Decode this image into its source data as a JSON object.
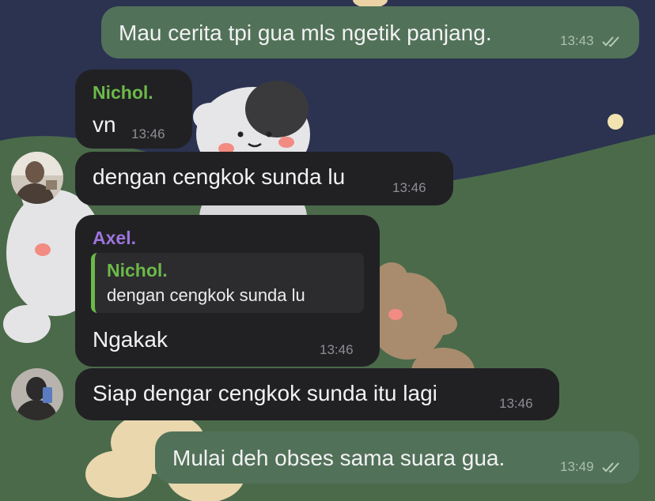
{
  "conversation": {
    "messages": [
      {
        "direction": "outgoing",
        "text": "Mau cerita tpi gua mls ngetik panjang.",
        "time": "13:43",
        "status": "read"
      },
      {
        "direction": "incoming",
        "sender": "Nichol.",
        "text": "vn",
        "time": "13:46"
      },
      {
        "direction": "incoming",
        "text": "dengan cengkok sunda lu",
        "time": "13:46"
      },
      {
        "direction": "incoming",
        "sender": "Axel.",
        "reply_to": {
          "sender": "Nichol.",
          "text": "dengan cengkok sunda lu"
        },
        "text": "Ngakak",
        "time": "13:46"
      },
      {
        "direction": "incoming",
        "text": "Siap dengar cengkok sunda itu lagi",
        "time": "13:46"
      },
      {
        "direction": "outgoing",
        "text": "Mulai deh obses sama suara gua.",
        "time": "13:49",
        "status": "read"
      }
    ]
  },
  "colors": {
    "outgoing_bubble": "#527159",
    "incoming_bubble": "#212124",
    "sender_nichol": "#6cba48",
    "sender_axel": "#9e74dc",
    "wallpaper_sky": "#2b3350",
    "wallpaper_hill": "#4b6a4a"
  },
  "icons": {
    "read_status": "double-check-icon"
  }
}
